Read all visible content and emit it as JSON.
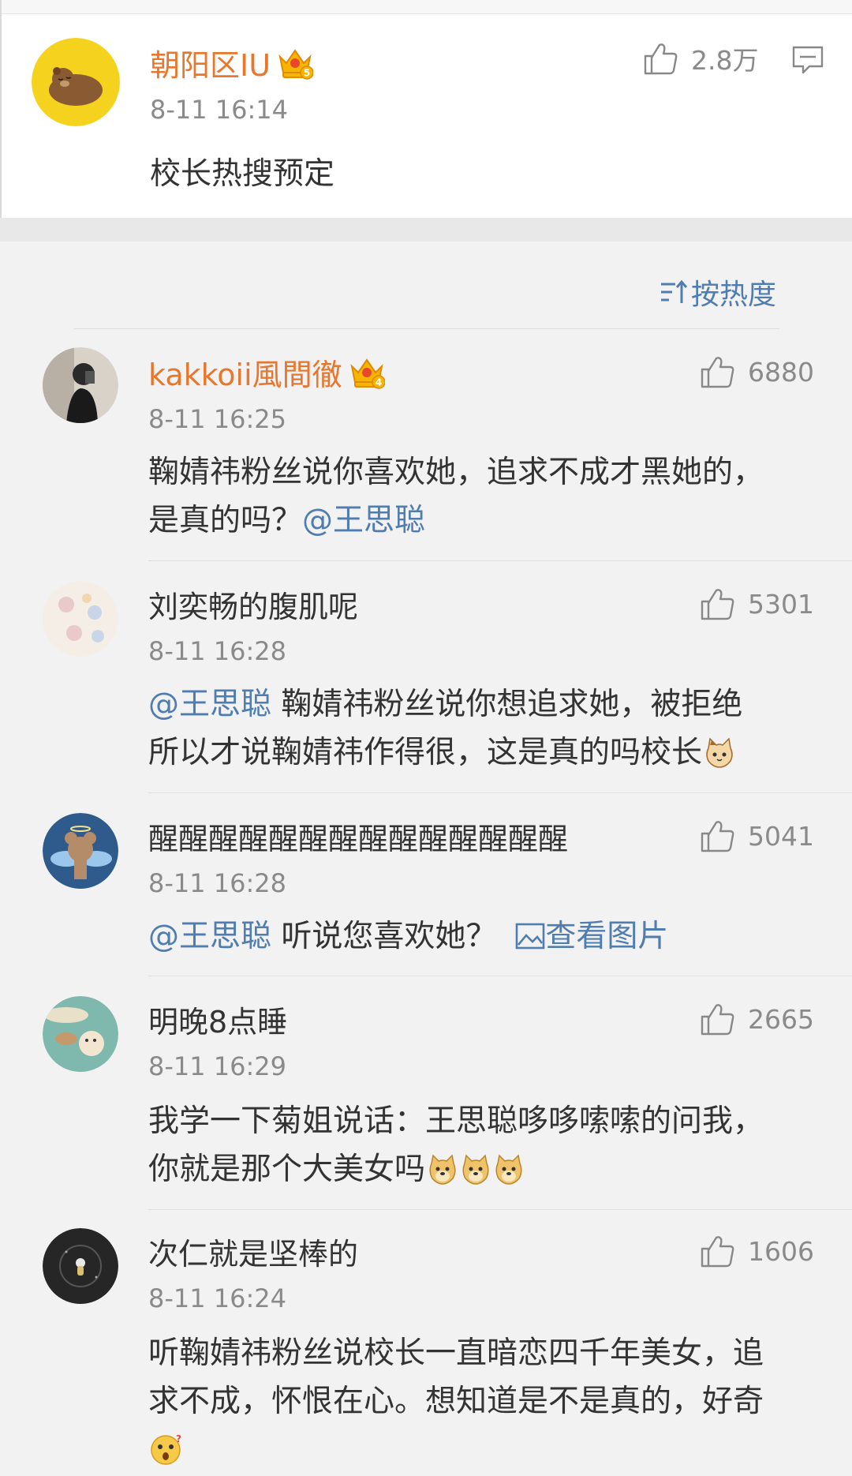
{
  "main_comment": {
    "username": "朝阳区IU",
    "time": "8-11 16:14",
    "text": "校长热搜预定",
    "likes": "2.8万",
    "crown_level": "5"
  },
  "sort_label": "按热度",
  "replies": [
    {
      "username": "kakkoii風間徹",
      "crown_level": "4",
      "time": "8-11 16:25",
      "likes": "6880",
      "text_line1": "鞠婧祎粉丝说你喜欢她，追求不成才黑她的，",
      "text_line2": "是真的吗？",
      "mention": "@王思聪"
    },
    {
      "username": "刘奕畅的腹肌呢",
      "time": "8-11 16:28",
      "likes": "5301",
      "mention": "@王思聪",
      "text_line1": " 鞠婧祎粉丝说你想追求她，被拒绝",
      "text_line2": "所以才说鞠婧祎作得很，这是真的吗校长"
    },
    {
      "username": "醒醒醒醒醒醒醒醒醒醒醒醒醒醒",
      "time": "8-11 16:28",
      "likes": "5041",
      "mention": "@王思聪",
      "text": " 听说您喜欢她？",
      "pic_link": "查看图片"
    },
    {
      "username": "明晚8点睡",
      "time": "8-11 16:29",
      "likes": "2665",
      "text_line1": "我学一下菊姐说话：王思聪哆哆嗦嗦的问我，",
      "text_line2": "你就是那个大美女吗"
    },
    {
      "username": "次仁就是坚棒的",
      "time": "8-11 16:24",
      "likes": "1606",
      "text_line1": "听鞠婧祎粉丝说校长一直暗恋四千年美女，追",
      "text_line2": "求不成，怀恨在心。想知道是不是真的，好奇"
    }
  ],
  "colors": {
    "vip_name": "#e8772e",
    "link": "#507daf",
    "meta": "#8a8a8a"
  }
}
